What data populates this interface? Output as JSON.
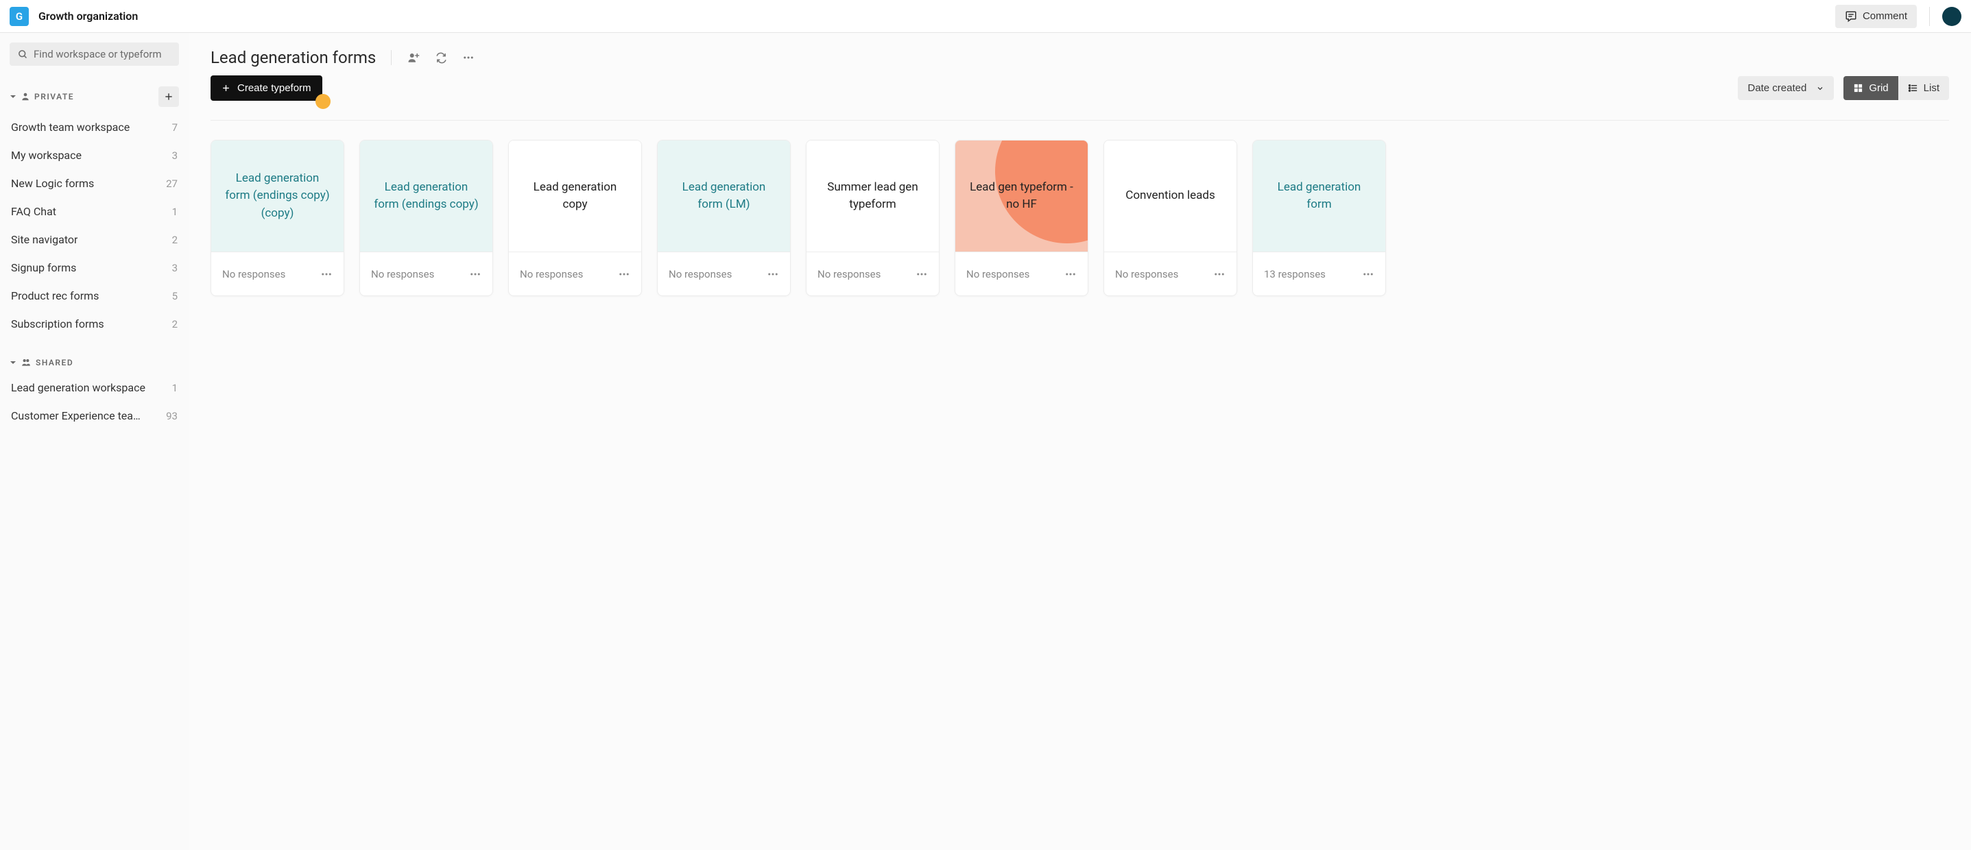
{
  "org": {
    "initial": "G",
    "name": "Growth organization"
  },
  "topbar": {
    "comment_label": "Comment"
  },
  "search": {
    "placeholder": "Find workspace or typeform"
  },
  "sidebar": {
    "private_label": "Private",
    "shared_label": "Shared",
    "private_items": [
      {
        "name": "Growth team workspace",
        "count": "7"
      },
      {
        "name": "My workspace",
        "count": "3"
      },
      {
        "name": "New Logic forms",
        "count": "27"
      },
      {
        "name": "FAQ Chat",
        "count": "1"
      },
      {
        "name": "Site navigator",
        "count": "2"
      },
      {
        "name": "Signup forms",
        "count": "3"
      },
      {
        "name": "Product rec forms",
        "count": "5"
      },
      {
        "name": "Subscription forms",
        "count": "2"
      }
    ],
    "shared_items": [
      {
        "name": "Lead generation workspace",
        "count": "1"
      },
      {
        "name": "Customer Experience team …",
        "count": "93"
      }
    ]
  },
  "page": {
    "title": "Lead generation forms"
  },
  "toolbar": {
    "create_label": "Create typeform",
    "sort_label": "Date created",
    "grid_label": "Grid",
    "list_label": "List"
  },
  "cards": [
    {
      "title": "Lead generation form (endings copy) (copy)",
      "responses": "No responses",
      "bg": "teal",
      "title_color": "teal"
    },
    {
      "title": "Lead generation form (endings copy)",
      "responses": "No responses",
      "bg": "teal",
      "title_color": "teal"
    },
    {
      "title": "Lead generation copy",
      "responses": "No responses",
      "bg": "white",
      "title_color": "black"
    },
    {
      "title": "Lead generation form (LM)",
      "responses": "No responses",
      "bg": "teal",
      "title_color": "teal"
    },
    {
      "title": "Summer lead gen typeform",
      "responses": "No responses",
      "bg": "white",
      "title_color": "black"
    },
    {
      "title": "Lead gen typeform - no HF",
      "responses": "No responses",
      "bg": "salmon",
      "title_color": "black",
      "circle": true
    },
    {
      "title": "Convention leads",
      "responses": "No responses",
      "bg": "white",
      "title_color": "black"
    },
    {
      "title": "Lead generation form",
      "responses": "13 responses",
      "bg": "teal",
      "title_color": "teal"
    }
  ]
}
